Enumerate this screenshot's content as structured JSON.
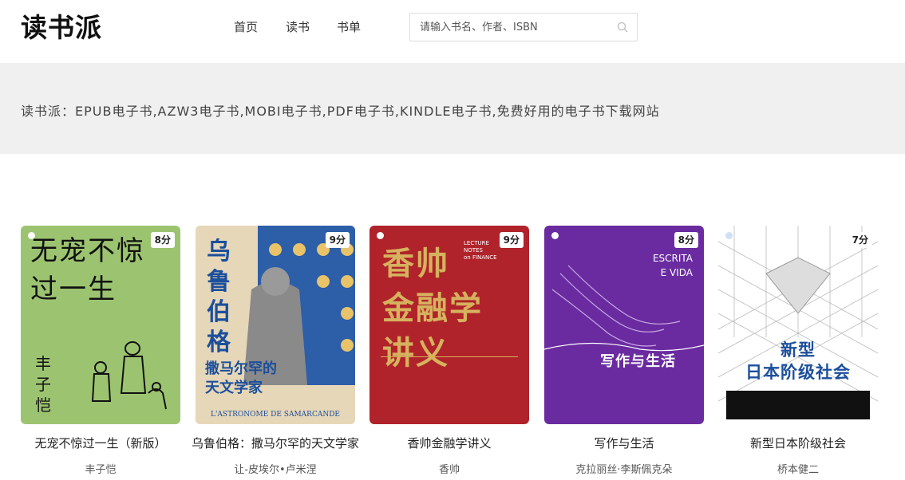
{
  "header": {
    "logo": "读书派",
    "nav": [
      "首页",
      "读书",
      "书单"
    ],
    "search_placeholder": "请输入书名、作者、ISBN"
  },
  "banner": {
    "text": "读书派：EPUB电子书,AZW3电子书,MOBI电子书,PDF电子书,KINDLE电子书,免费好用的电子书下载网站"
  },
  "books": [
    {
      "title": "无宠不惊过一生（新版）",
      "author": "丰子恺",
      "score": "8分",
      "cover_text": "无宠不惊\n过一生",
      "cover_author": "丰子恺"
    },
    {
      "title": "乌鲁伯格：撒马尔罕的天文学家",
      "author": "让-皮埃尔•卢米涅",
      "score": "9分",
      "cover_text": "乌鲁伯格",
      "cover_subtitle": "撒马尔罕的\n天文学家",
      "cover_foot": "L'ASTRONOME DE SAMARCANDE"
    },
    {
      "title": "香帅金融学讲义",
      "author": "香帅",
      "score": "9分",
      "cover_text": "香帅\n金融学\n讲义",
      "cover_tag": "LECTURE\nNOTES\non FINANCE"
    },
    {
      "title": "写作与生活",
      "author": "克拉丽丝·李斯佩克朵",
      "score": "8分",
      "cover_top": "ESCRITA\nE VIDA",
      "cover_text": "写作与生活"
    },
    {
      "title": "新型日本阶级社会",
      "author": "桥本健二",
      "score": "7分",
      "cover_text": "新型\n日本阶级社会"
    }
  ],
  "colors": {
    "banner_bg": "#f0f0f0",
    "cover_1": "#9cc470",
    "cover_2": "#e6d7b8",
    "cover_3": "#b0232a",
    "cover_4": "#6a2ba0",
    "cover_5": "#ffffff"
  }
}
